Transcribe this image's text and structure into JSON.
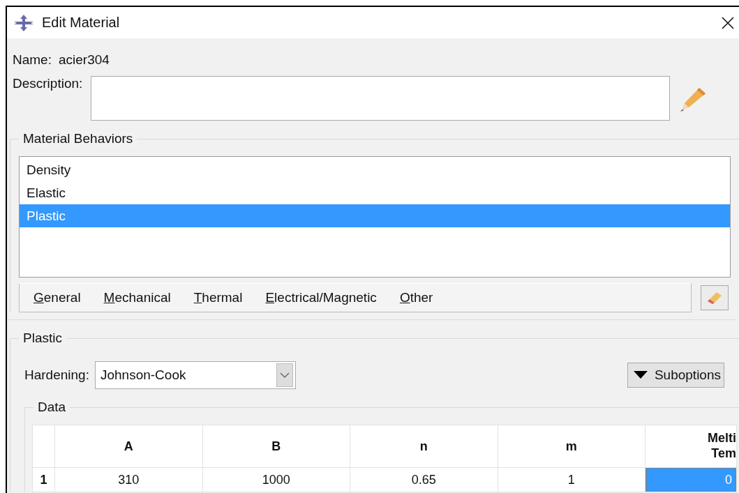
{
  "window": {
    "title": "Edit Material"
  },
  "name": {
    "label": "Name:",
    "value": "acier304"
  },
  "description": {
    "label": "Description:"
  },
  "material_behaviors": {
    "title": "Material Behaviors",
    "items": [
      {
        "label": "Density",
        "selected": false
      },
      {
        "label": "Elastic",
        "selected": false
      },
      {
        "label": "Plastic",
        "selected": true
      }
    ]
  },
  "menu": [
    "General",
    "Mechanical",
    "Thermal",
    "Electrical/Magnetic",
    "Other"
  ],
  "plastic": {
    "title": "Plastic",
    "hardening_label": "Hardening:",
    "hardening_value": "Johnson-Cook",
    "suboptions": "Suboptions",
    "data": {
      "title": "Data",
      "columns": [
        "A",
        "B",
        "n",
        "m",
        "Melti\nTem"
      ],
      "rows": [
        {
          "index": "1",
          "cells": [
            {
              "value": "310",
              "selected": false
            },
            {
              "value": "1000",
              "selected": false
            },
            {
              "value": "0.65",
              "selected": false
            },
            {
              "value": "1",
              "selected": false
            },
            {
              "value": "0",
              "selected": true
            }
          ]
        }
      ]
    }
  }
}
